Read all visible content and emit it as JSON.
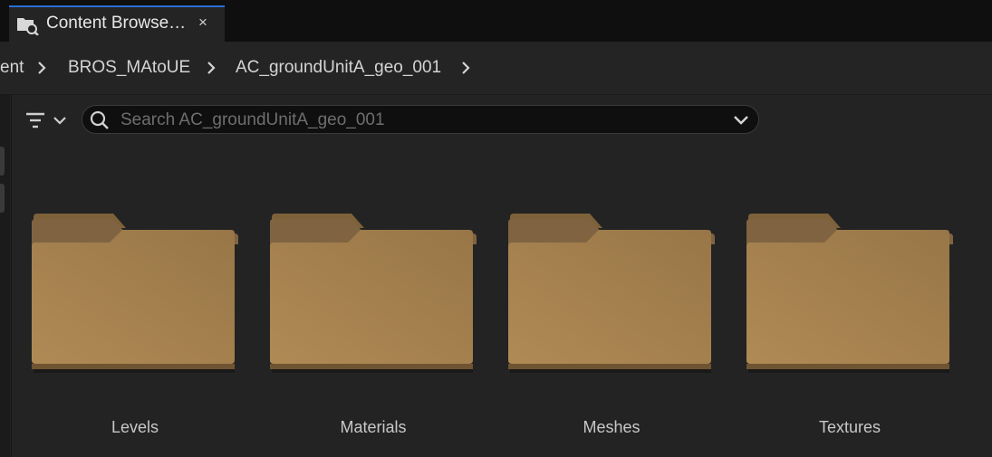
{
  "tab": {
    "title": "Content Browse…",
    "close_label": "×",
    "icon": "content-browser-icon"
  },
  "breadcrumb": {
    "items": [
      "ent",
      "BROS_MAtoUE",
      "AC_groundUnitA_geo_001"
    ],
    "separator_icon": "chevron-right-icon"
  },
  "toolbar": {
    "filter_icon": "filter-icon",
    "search_placeholder": "Search AC_groundUnitA_geo_001",
    "search_value": ""
  },
  "folders": [
    {
      "label": "Levels"
    },
    {
      "label": "Materials"
    },
    {
      "label": "Meshes"
    },
    {
      "label": "Textures"
    }
  ],
  "colors": {
    "folder": "#a98552",
    "folder_dark": "#8a6a3e",
    "accent": "#2a6fd6",
    "panel": "#242424"
  }
}
